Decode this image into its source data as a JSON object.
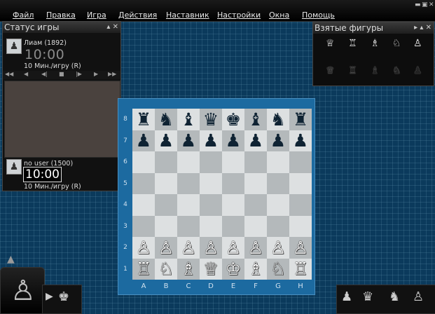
{
  "menu": [
    "Файл",
    "Правка",
    "Игра",
    "Действия",
    "Наставник",
    "Настройки",
    "Окна",
    "Помощь"
  ],
  "window_controls": [
    "minimize-icon",
    "maximize-icon",
    "close-icon"
  ],
  "status_panel": {
    "title": "Статус игры",
    "top_player": {
      "name": "Лиам (1892)",
      "clock": "10:00",
      "time_control": "10 Мин./игру (R)"
    },
    "bottom_player": {
      "name": "no user (1500)",
      "clock": "10:00",
      "time_control": "10 Мин./игру (R)"
    },
    "nav_buttons": [
      "first-icon",
      "prev-fast-icon",
      "prev-icon",
      "stop-icon",
      "next-icon",
      "next-fast-icon",
      "last-icon"
    ]
  },
  "captured_panel": {
    "title": "Взятые фигуры",
    "white_pieces": [
      "♕",
      "♖",
      "♗",
      "♘",
      "♙"
    ],
    "black_pieces": [
      "♛",
      "♜",
      "♝",
      "♞",
      "♟"
    ]
  },
  "board": {
    "ranks": [
      "8",
      "7",
      "6",
      "5",
      "4",
      "3",
      "2",
      "1"
    ],
    "files": [
      "A",
      "B",
      "C",
      "D",
      "E",
      "F",
      "G",
      "H"
    ],
    "position": [
      [
        "♜",
        "♞",
        "♝",
        "♛",
        "♚",
        "♝",
        "♞",
        "♜"
      ],
      [
        "♟",
        "♟",
        "♟",
        "♟",
        "♟",
        "♟",
        "♟",
        "♟"
      ],
      [
        "",
        "",
        "",
        "",
        "",
        "",
        "",
        ""
      ],
      [
        "",
        "",
        "",
        "",
        "",
        "",
        "",
        ""
      ],
      [
        "",
        "",
        "",
        "",
        "",
        "",
        "",
        ""
      ],
      [
        "",
        "",
        "",
        "",
        "",
        "",
        "",
        ""
      ],
      [
        "♙",
        "♙",
        "♙",
        "♙",
        "♙",
        "♙",
        "♙",
        "♙"
      ],
      [
        "♖",
        "♘",
        "♗",
        "♕",
        "♔",
        "♗",
        "♘",
        "♖"
      ]
    ],
    "light_color": "#dde0e1",
    "dark_color": "#b4b9bb"
  },
  "colors": {
    "background": "#0b3a5c",
    "board_frame": "#1c6aa0"
  }
}
